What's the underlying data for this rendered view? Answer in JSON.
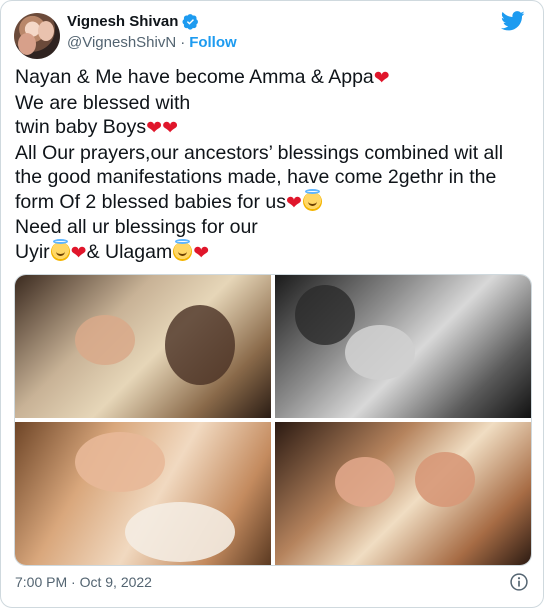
{
  "author": {
    "name": "Vignesh Shivan",
    "handle": "@VigneshShivN",
    "separator": "·",
    "follow_label": "Follow",
    "verified": true
  },
  "tweet": {
    "lines": [
      "Nayan & Me have become Amma & Appa",
      "We are blessed with",
      "twin baby Boys",
      "All Our prayers,our ancestors’ blessings combined wit all",
      "the good manifestations made, have come 2gethr in the",
      "form Of 2 blessed babies for us",
      "Need all ur blessings for our",
      "Uyir",
      "& Ulagam"
    ]
  },
  "media": {
    "count": 4
  },
  "timestamp": "7:00 PM · Oct 9, 2022",
  "icons": {
    "platform": "twitter-bird-icon",
    "verified": "verified-badge-icon",
    "info": "info-icon",
    "heart": "red-heart-emoji",
    "halo": "smiling-face-with-halo-emoji"
  },
  "colors": {
    "accent": "#1d9bf0",
    "text": "#0f1419",
    "secondary": "#536471",
    "border": "#cfd9de",
    "heart": "#e0162b"
  }
}
